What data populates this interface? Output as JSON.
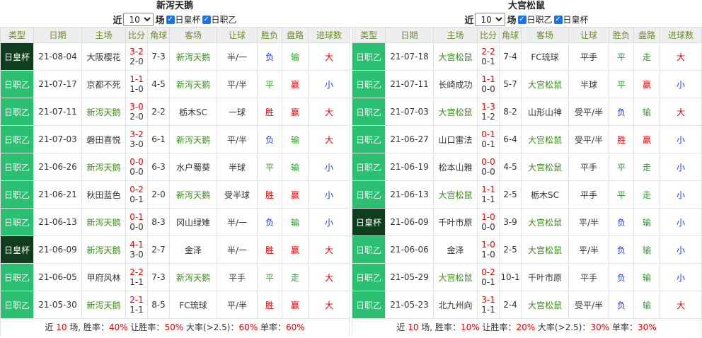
{
  "panels": [
    {
      "id": "left",
      "title": "新泻天鹅",
      "filter": {
        "prefix": "近",
        "count": "10",
        "suffix": "场",
        "checkboxes": [
          "日皇杯",
          "日职乙"
        ]
      },
      "headers": [
        "类型",
        "日期",
        "主场",
        "比分",
        "角球",
        "客场",
        "让球",
        "胜负",
        "盘路",
        "进球数"
      ],
      "rows": [
        {
          "league": "日皇杯",
          "league_style": "eq",
          "date": "21-08-04",
          "home": "大阪樱花",
          "home_hl": false,
          "ft": "3-2",
          "ht": "2-0",
          "corner": "7-3",
          "away": "新泻天鹅",
          "away_hl": true,
          "handicap": "半/一",
          "result": "负",
          "result_t": "lose",
          "pan": "输",
          "pan_t": "lose",
          "size": "大",
          "size_t": "big"
        },
        {
          "league": "日职乙",
          "league_style": "jc",
          "date": "21-07-17",
          "home": "京都不死",
          "home_hl": false,
          "ft": "1-1",
          "ht": "1-0",
          "corner": "4-5",
          "away": "新泻天鹅",
          "away_hl": true,
          "handicap": "平/半",
          "result": "平",
          "result_t": "draw",
          "pan": "赢",
          "pan_t": "win",
          "size": "小",
          "size_t": "small"
        },
        {
          "league": "日职乙",
          "league_style": "jc",
          "date": "21-07-11",
          "home": "新泻天鹅",
          "home_hl": true,
          "ft": "3-0",
          "ht": "2-0",
          "corner": "2-2",
          "away": "栃木SC",
          "away_hl": false,
          "handicap": "一球",
          "result": "胜",
          "result_t": "win",
          "pan": "赢",
          "pan_t": "win",
          "size": "大",
          "size_t": "big"
        },
        {
          "league": "日职乙",
          "league_style": "jc",
          "date": "21-07-03",
          "home": "磐田喜悦",
          "home_hl": false,
          "ft": "3-2",
          "ht": "3-0",
          "corner": "6-1",
          "away": "新泻天鹅",
          "away_hl": true,
          "handicap": "平/半",
          "result": "负",
          "result_t": "lose",
          "pan": "输",
          "pan_t": "lose",
          "size": "大",
          "size_t": "big"
        },
        {
          "league": "日职乙",
          "league_style": "jc",
          "date": "21-06-26",
          "home": "新泻天鹅",
          "home_hl": true,
          "ft": "0-0",
          "ht": "0-0",
          "corner": "6-3",
          "away": "水户蜀葵",
          "away_hl": false,
          "handicap": "半球",
          "result": "平",
          "result_t": "draw",
          "pan": "输",
          "pan_t": "lose",
          "size": "小",
          "size_t": "small"
        },
        {
          "league": "日职乙",
          "league_style": "jc",
          "date": "21-06-21",
          "home": "秋田蓝色",
          "home_hl": false,
          "ft": "0-2",
          "ht": "0-1",
          "corner": "2-0",
          "away": "新泻天鹅",
          "away_hl": true,
          "handicap": "受半球",
          "result": "胜",
          "result_t": "win",
          "pan": "赢",
          "pan_t": "win",
          "size": "小",
          "size_t": "small"
        },
        {
          "league": "日职乙",
          "league_style": "jc",
          "date": "21-06-13",
          "home": "新泻天鹅",
          "home_hl": true,
          "ft": "0-1",
          "ht": "0-0",
          "corner": "8-3",
          "away": "冈山绿雉",
          "away_hl": false,
          "handicap": "半/一",
          "result": "负",
          "result_t": "lose",
          "pan": "输",
          "pan_t": "lose",
          "size": "小",
          "size_t": "small"
        },
        {
          "league": "日皇杯",
          "league_style": "eq",
          "date": "21-06-09",
          "home": "新泻天鹅",
          "home_hl": true,
          "ft": "4-1",
          "ht": "3-0",
          "corner": "2-7",
          "away": "金泽",
          "away_hl": false,
          "handicap": "半/一",
          "result": "胜",
          "result_t": "win",
          "pan": "赢",
          "pan_t": "win",
          "size": "大",
          "size_t": "big"
        },
        {
          "league": "日职乙",
          "league_style": "jc",
          "date": "21-06-05",
          "home": "甲府风林",
          "home_hl": false,
          "ft": "2-2",
          "ht": "1-1",
          "corner": "7-3",
          "away": "新泻天鹅",
          "away_hl": true,
          "handicap": "平手",
          "result": "平",
          "result_t": "draw",
          "pan": "走",
          "pan_t": "walk",
          "size": "大",
          "size_t": "big"
        },
        {
          "league": "日职乙",
          "league_style": "jc",
          "date": "21-05-30",
          "home": "新泻天鹅",
          "home_hl": true,
          "ft": "2-1",
          "ht": "1-1",
          "corner": "8-5",
          "away": "FC琉球",
          "away_hl": false,
          "handicap": "平/半",
          "result": "胜",
          "result_t": "win",
          "pan": "赢",
          "pan_t": "win",
          "size": "大",
          "size_t": "big"
        }
      ],
      "footer": {
        "p1": "近 ",
        "count": "10",
        "p2": " 场, 胜率：",
        "win_rate": "40%",
        "p3": " 让胜率：",
        "handicap_rate": "50%",
        "p4": " 大率(>2.5)：",
        "big_rate": "60%",
        "p5": " 单率：",
        "odd_rate": "60%"
      }
    },
    {
      "id": "right",
      "title": "大宫松鼠",
      "filter": {
        "prefix": "近",
        "count": "10",
        "suffix": "场",
        "checkboxes": [
          "日职乙",
          "日皇杯"
        ]
      },
      "headers": [
        "类型",
        "日期",
        "主场",
        "比分",
        "角球",
        "客场",
        "让球",
        "胜负",
        "盘路",
        "进球数"
      ],
      "rows": [
        {
          "league": "日职乙",
          "league_style": "jc",
          "date": "21-07-18",
          "home": "大宫松鼠",
          "home_hl": true,
          "ft": "2-2",
          "ht": "0-1",
          "corner": "7-4",
          "away": "FC琉球",
          "away_hl": false,
          "handicap": "平手",
          "result": "平",
          "result_t": "draw",
          "pan": "走",
          "pan_t": "walk",
          "size": "大",
          "size_t": "big"
        },
        {
          "league": "日职乙",
          "league_style": "jc",
          "date": "21-07-11",
          "home": "长崎成功",
          "home_hl": false,
          "ft": "1-1",
          "ht": "0-0",
          "corner": "5-7",
          "away": "大宫松鼠",
          "away_hl": true,
          "handicap": "半球",
          "result": "平",
          "result_t": "draw",
          "pan": "赢",
          "pan_t": "win",
          "size": "小",
          "size_t": "small"
        },
        {
          "league": "日职乙",
          "league_style": "jc",
          "date": "21-07-03",
          "home": "大宫松鼠",
          "home_hl": true,
          "ft": "1-3",
          "ht": "1-2",
          "corner": "8-2",
          "away": "山形山神",
          "away_hl": false,
          "handicap": "受平/半",
          "result": "负",
          "result_t": "lose",
          "pan": "输",
          "pan_t": "lose",
          "size": "大",
          "size_t": "big"
        },
        {
          "league": "日职乙",
          "league_style": "jc",
          "date": "21-06-27",
          "home": "山口雷法",
          "home_hl": false,
          "ft": "0-1",
          "ht": "0-1",
          "corner": "6-4",
          "away": "大宫松鼠",
          "away_hl": true,
          "handicap": "受平/半",
          "result": "胜",
          "result_t": "win",
          "pan": "赢",
          "pan_t": "win",
          "size": "小",
          "size_t": "small"
        },
        {
          "league": "日职乙",
          "league_style": "jc",
          "date": "21-06-19",
          "home": "松本山雅",
          "home_hl": false,
          "ft": "0-0",
          "ht": "0-0",
          "corner": "4-5",
          "away": "大宫松鼠",
          "away_hl": true,
          "handicap": "平手",
          "result": "平",
          "result_t": "draw",
          "pan": "走",
          "pan_t": "walk",
          "size": "小",
          "size_t": "small"
        },
        {
          "league": "日职乙",
          "league_style": "jc",
          "date": "21-06-13",
          "home": "大宫松鼠",
          "home_hl": true,
          "ft": "1-1",
          "ht": "1-1",
          "corner": "2-5",
          "away": "栃木SC",
          "away_hl": false,
          "handicap": "平手",
          "result": "平",
          "result_t": "draw",
          "pan": "走",
          "pan_t": "walk",
          "size": "小",
          "size_t": "small"
        },
        {
          "league": "日皇杯",
          "league_style": "eq",
          "date": "21-06-09",
          "home": "千叶市原",
          "home_hl": false,
          "ft": "1-0",
          "ht": "0-0",
          "corner": "3-9",
          "away": "大宫松鼠",
          "away_hl": true,
          "handicap": "平/半",
          "result": "负",
          "result_t": "lose",
          "pan": "输",
          "pan_t": "lose",
          "size": "小",
          "size_t": "small"
        },
        {
          "league": "日职乙",
          "league_style": "jc",
          "date": "21-06-06",
          "home": "金泽",
          "home_hl": false,
          "ft": "1-0",
          "ht": "1-0",
          "corner": "2-5",
          "away": "大宫松鼠",
          "away_hl": true,
          "handicap": "平/半",
          "result": "负",
          "result_t": "lose",
          "pan": "输",
          "pan_t": "lose",
          "size": "小",
          "size_t": "small"
        },
        {
          "league": "日职乙",
          "league_style": "jc",
          "date": "21-05-29",
          "home": "大宫松鼠",
          "home_hl": true,
          "ft": "0-2",
          "ht": "0-1",
          "corner": "10-1",
          "away": "千叶市原",
          "away_hl": false,
          "handicap": "平手",
          "result": "负",
          "result_t": "lose",
          "pan": "输",
          "pan_t": "lose",
          "size": "小",
          "size_t": "small"
        },
        {
          "league": "日职乙",
          "league_style": "jc",
          "date": "21-05-23",
          "home": "北九州向",
          "home_hl": false,
          "ft": "3-1",
          "ht": "1-1",
          "corner": "2-4",
          "away": "大宫松鼠",
          "away_hl": true,
          "handicap": "受平/半",
          "result": "负",
          "result_t": "lose",
          "pan": "输",
          "pan_t": "lose",
          "size": "大",
          "size_t": "big"
        }
      ],
      "footer": {
        "p1": "近 ",
        "count": "10",
        "p2": " 场, 胜率：",
        "win_rate": "10%",
        "p3": " 让胜率：",
        "handicap_rate": "20%",
        "p4": " 大率(>2.5)：",
        "big_rate": "30%",
        "p5": " 单率：",
        "odd_rate": "30%"
      }
    }
  ]
}
